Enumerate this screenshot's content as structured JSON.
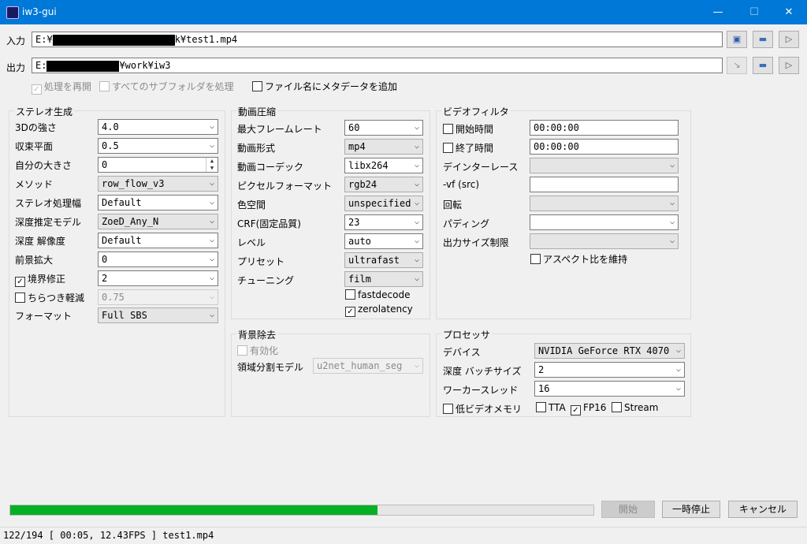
{
  "window": {
    "title": "iw3-gui",
    "minimize": "—",
    "maximize": "☐",
    "close": "✕"
  },
  "io": {
    "input_label": "入力",
    "input_prefix": "E:¥",
    "input_suffix": "k¥test1.mp4",
    "output_label": "出力",
    "output_prefix": "E:",
    "output_suffix": "¥work¥iw3"
  },
  "options": {
    "resume": "処理を再開",
    "subfolders": "すべてのサブフォルダを処理",
    "metadata": "ファイル名にメタデータを追加"
  },
  "stereo": {
    "title": "ステレオ生成",
    "rows": [
      {
        "label": "3Dの強さ",
        "value": "4.0"
      },
      {
        "label": "収束平面",
        "value": "0.5"
      },
      {
        "label": "自分の大きさ",
        "value": "0"
      },
      {
        "label": "メソッド",
        "value": "row_flow_v3"
      },
      {
        "label": "ステレオ処理幅",
        "value": "Default"
      },
      {
        "label": "深度推定モデル",
        "value": "ZoeD_Any_N"
      },
      {
        "label": "深度 解像度",
        "value": "Default"
      },
      {
        "label": "前景拡大",
        "value": "0"
      },
      {
        "label": "境界修正",
        "value": "2"
      },
      {
        "label": "ちらつき軽減",
        "value": "0.75"
      },
      {
        "label": "フォーマット",
        "value": "Full SBS"
      }
    ]
  },
  "video": {
    "title": "動画圧縮",
    "rows": [
      {
        "label": "最大フレームレート",
        "value": "60"
      },
      {
        "label": "動画形式",
        "value": "mp4"
      },
      {
        "label": "動画コーデック",
        "value": "libx264"
      },
      {
        "label": "ピクセルフォーマット",
        "value": "rgb24"
      },
      {
        "label": "色空間",
        "value": "unspecified"
      },
      {
        "label": "CRF(固定品質)",
        "value": "23"
      },
      {
        "label": "レベル",
        "value": "auto"
      },
      {
        "label": "プリセット",
        "value": "ultrafast"
      },
      {
        "label": "チューニング",
        "value": "film"
      }
    ],
    "fastdecode": "fastdecode",
    "zerolatency": "zerolatency"
  },
  "filter": {
    "title": "ビデオフィルタ",
    "start_label": "開始時間",
    "start_value": "00:00:00",
    "end_label": "終了時間",
    "end_value": "00:00:00",
    "deinterlace": "デインターレース",
    "vf": "-vf (src)",
    "rotate": "回転",
    "padding": "パディング",
    "outsize": "出力サイズ制限",
    "keep_aspect": "アスペクト比を維持"
  },
  "bg": {
    "title": "背景除去",
    "enable": "有効化",
    "model_label": "領域分割モデル",
    "model_value": "u2net_human_seg"
  },
  "proc": {
    "title": "プロセッサ",
    "device_label": "デバイス",
    "device_value": "NVIDIA GeForce RTX 4070",
    "batch_label": "深度 バッチサイズ",
    "batch_value": "2",
    "worker_label": "ワーカースレッド",
    "worker_value": "16",
    "lowvram": "低ビデオメモリ",
    "tta": "TTA",
    "fp16": "FP16",
    "stream": "Stream"
  },
  "actions": {
    "start": "開始",
    "pause": "一時停止",
    "cancel": "キャンセル"
  },
  "progress_fraction": 0.63,
  "status_text": "122/194 [ 00:05, 12.43FPS ] test1.mp4"
}
